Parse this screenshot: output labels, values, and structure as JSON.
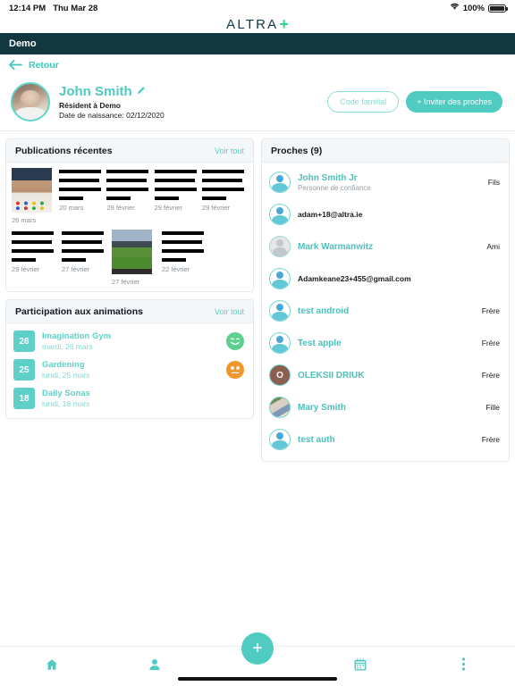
{
  "status_bar": {
    "time": "12:14 PM",
    "date": "Thu Mar 28",
    "battery": "100%",
    "wifi_icon": "wifi-icon",
    "battery_icon": "battery-full-icon"
  },
  "logo": {
    "word": "ALTRA",
    "plus": "+"
  },
  "app_header": {
    "title": "Demo"
  },
  "back": {
    "arrow_icon": "arrow-left-icon",
    "label": "Retour"
  },
  "profile": {
    "name": "John Smith",
    "edit_icon": "pencil-icon",
    "role": "Résident à Demo",
    "dob": "Date de naissance: 02/12/2020",
    "code_button": "Code familial",
    "invite_button": "+ Inviter des proches"
  },
  "publications": {
    "title": "Publications récentes",
    "see_all": "Voir tout",
    "items": [
      {
        "date": "26 mars",
        "thumb": "photo-bingo"
      },
      {
        "date": "20 mars",
        "thumb": "text"
      },
      {
        "date": "29 février",
        "thumb": "text"
      },
      {
        "date": "29 février",
        "thumb": "text"
      },
      {
        "date": "29 février",
        "thumb": "text"
      },
      {
        "date": "29 février",
        "thumb": "text"
      },
      {
        "date": "27 février",
        "thumb": "text"
      },
      {
        "date": "27 février",
        "thumb": "photo-stadium"
      },
      {
        "date": "22 février",
        "thumb": "text"
      }
    ]
  },
  "participation": {
    "title": "Participation aux animations",
    "see_all": "Voir tout",
    "items": [
      {
        "day": "26",
        "name": "Imagination Gym",
        "date": "mardi, 26 mars",
        "mood": "happy"
      },
      {
        "day": "25",
        "name": "Gardening",
        "date": "lundi, 25 mars",
        "mood": "neutral"
      },
      {
        "day": "18",
        "name": "Daily Sonas",
        "date": "lundi, 18 mars",
        "mood": "none"
      }
    ]
  },
  "proches": {
    "title": "Proches (9)",
    "items": [
      {
        "name": "John Smith Jr",
        "sub": "Personne de confiance",
        "relation": "Fils",
        "avatar": "default",
        "is_email": false
      },
      {
        "name": "adam+18@altra.ie",
        "sub": "",
        "relation": "",
        "avatar": "default",
        "is_email": true
      },
      {
        "name": "Mark Warmanwitz",
        "sub": "",
        "relation": "Ami",
        "avatar": "grey",
        "is_email": false
      },
      {
        "name": "Adamkeane23+455@gmail.com",
        "sub": "",
        "relation": "",
        "avatar": "default",
        "is_email": true
      },
      {
        "name": "test android",
        "sub": "",
        "relation": "Frère",
        "avatar": "default",
        "is_email": false
      },
      {
        "name": "Test apple",
        "sub": "",
        "relation": "Frère",
        "avatar": "default",
        "is_email": false
      },
      {
        "name": "OLEKSII DRIUK",
        "sub": "",
        "relation": "Frère",
        "avatar": "initial",
        "initial": "O",
        "is_email": false
      },
      {
        "name": "Mary Smith",
        "sub": "",
        "relation": "Fille",
        "avatar": "photo",
        "is_email": false
      },
      {
        "name": "test auth",
        "sub": "",
        "relation": "Frère",
        "avatar": "default",
        "is_email": false
      }
    ]
  },
  "tabbar": {
    "items": [
      {
        "icon": "home-icon"
      },
      {
        "icon": "person-icon"
      },
      {
        "icon": "plus-icon"
      },
      {
        "icon": "calendar-icon"
      },
      {
        "icon": "more-vertical-icon"
      }
    ]
  }
}
